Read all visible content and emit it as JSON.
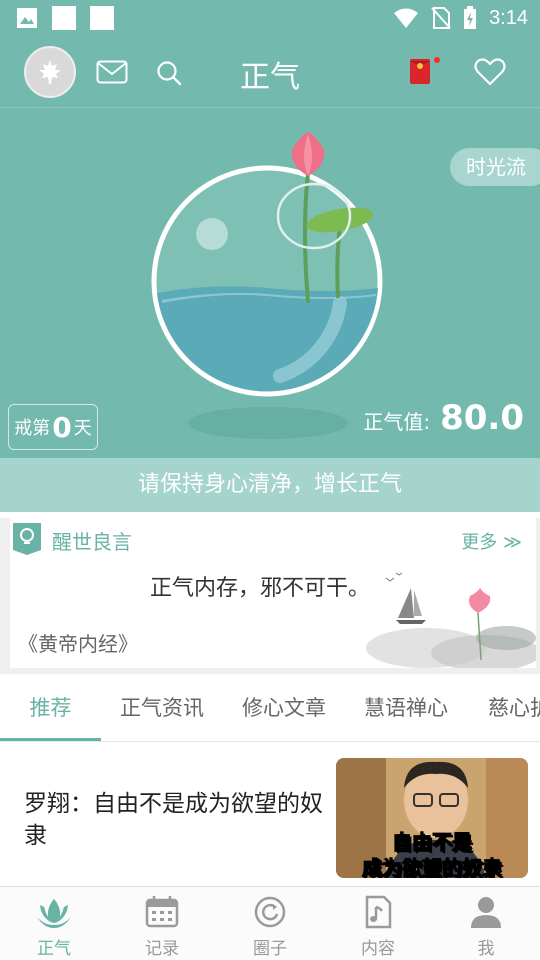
{
  "status_bar": {
    "time": "3:14"
  },
  "header": {
    "title": "正气"
  },
  "hero": {
    "time_flow_label": "时光流",
    "days_prefix": "戒第",
    "days_count": "0",
    "days_suffix": "天",
    "value_label": "正气值:",
    "value": "80.0"
  },
  "banner": {
    "text": "请保持身心清净，增长正气"
  },
  "quote_card": {
    "title": "醒世良言",
    "more_label": "更多 ≫",
    "quote": "正气内存，邪不可干。",
    "source": "《黄帝内经》"
  },
  "tabs": [
    {
      "label": "推荐",
      "active": true
    },
    {
      "label": "正气资讯",
      "active": false
    },
    {
      "label": "修心文章",
      "active": false
    },
    {
      "label": "慧语禅心",
      "active": false
    },
    {
      "label": "慈心护",
      "active": false
    }
  ],
  "article": {
    "title": "罗翔：自由不是成为欲望的奴隶",
    "thumb_line1": "自由不是",
    "thumb_line2": "成为欲望的奴隶"
  },
  "bottom_nav": [
    {
      "label": "正气",
      "icon": "lotus-icon",
      "active": true
    },
    {
      "label": "记录",
      "icon": "calendar-icon",
      "active": false
    },
    {
      "label": "圈子",
      "icon": "circle-refresh-icon",
      "active": false
    },
    {
      "label": "内容",
      "icon": "music-note-icon",
      "active": false
    },
    {
      "label": "我",
      "icon": "person-icon",
      "active": false
    }
  ],
  "colors": {
    "brand": "#73b9ad",
    "accent": "#69b3a6",
    "banner": "#a4d4cc",
    "red_packet": "#d9252b"
  }
}
